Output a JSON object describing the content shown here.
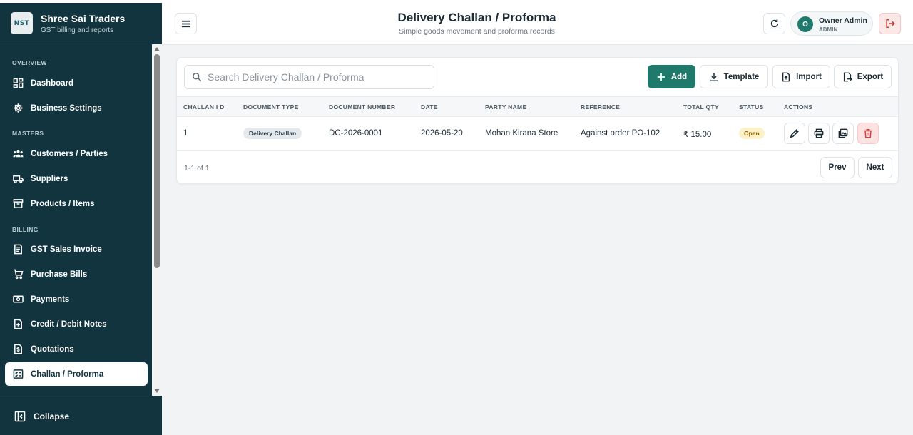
{
  "brand": {
    "logo_text": "NST",
    "name": "Shree Sai Traders",
    "subtitle": "GST billing and reports"
  },
  "sidebar": {
    "sections": {
      "overview": "OVERVIEW",
      "masters": "MASTERS",
      "billing": "BILLING"
    },
    "items": [
      {
        "label": "Dashboard",
        "icon": "dashboard-icon"
      },
      {
        "label": "Business Settings",
        "icon": "gear-icon"
      },
      {
        "label": "Customers / Parties",
        "icon": "users-icon"
      },
      {
        "label": "Suppliers",
        "icon": "truck-icon"
      },
      {
        "label": "Products / Items",
        "icon": "archive-box-icon"
      },
      {
        "label": "GST Sales Invoice",
        "icon": "invoice-icon"
      },
      {
        "label": "Purchase Bills",
        "icon": "cart-icon"
      },
      {
        "label": "Payments",
        "icon": "cash-icon"
      },
      {
        "label": "Credit / Debit Notes",
        "icon": "note-plus-icon"
      },
      {
        "label": "Quotations",
        "icon": "quotation-icon"
      },
      {
        "label": "Challan / Proforma",
        "icon": "checklist-icon",
        "active": true
      }
    ],
    "collapse_label": "Collapse"
  },
  "header": {
    "title": "Delivery Challan / Proforma",
    "subtitle": "Simple goods movement and proforma records",
    "user": {
      "initial": "O",
      "name": "Owner Admin",
      "role": "ADMIN"
    }
  },
  "toolbar": {
    "search_placeholder": "Search Delivery Challan / Proforma",
    "add_label": "Add",
    "template_label": "Template",
    "import_label": "Import",
    "export_label": "Export"
  },
  "table": {
    "columns": [
      "CHALLAN I D",
      "DOCUMENT TYPE",
      "DOCUMENT NUMBER",
      "DATE",
      "PARTY NAME",
      "REFERENCE",
      "TOTAL QTY",
      "STATUS",
      "ACTIONS"
    ],
    "rows": [
      {
        "challan_id": "1",
        "document_type": "Delivery Challan",
        "document_number": "DC-2026-0001",
        "date": "2026-05-20",
        "party_name": "Mohan Kirana Store",
        "reference": "Against order PO-102",
        "total_qty": "₹ 15.00",
        "status": "Open"
      }
    ]
  },
  "pagination": {
    "summary": "1-1 of 1",
    "prev_label": "Prev",
    "next_label": "Next"
  },
  "colors": {
    "sidebar_bg": "#11343e",
    "primary": "#1f7a6c",
    "danger_bg": "#fde2e2",
    "status_open_bg": "#fdf1c7"
  }
}
